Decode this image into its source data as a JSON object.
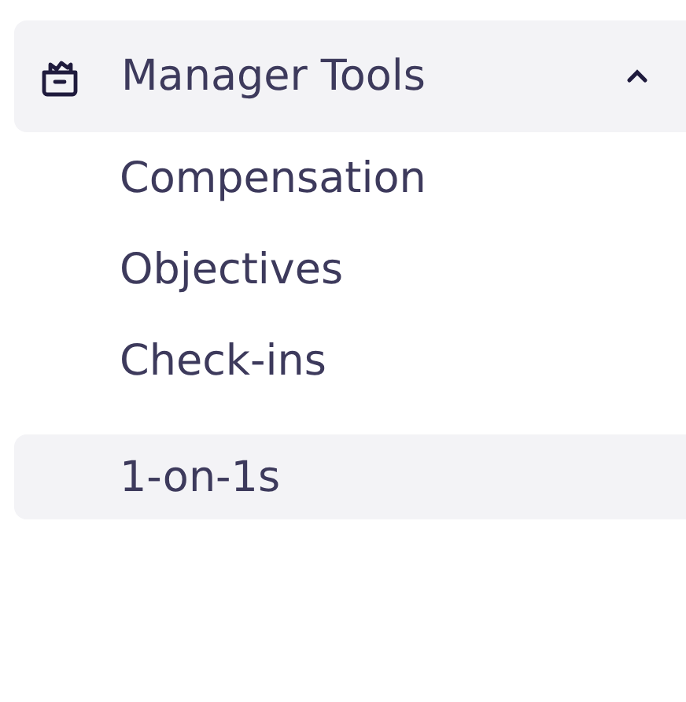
{
  "section": {
    "title": "Manager Tools",
    "expanded": true,
    "items": [
      {
        "label": "Compensation",
        "selected": false
      },
      {
        "label": "Objectives",
        "selected": false
      },
      {
        "label": "Check-ins",
        "selected": false
      },
      {
        "label": "1-on-1s",
        "selected": true
      }
    ]
  }
}
